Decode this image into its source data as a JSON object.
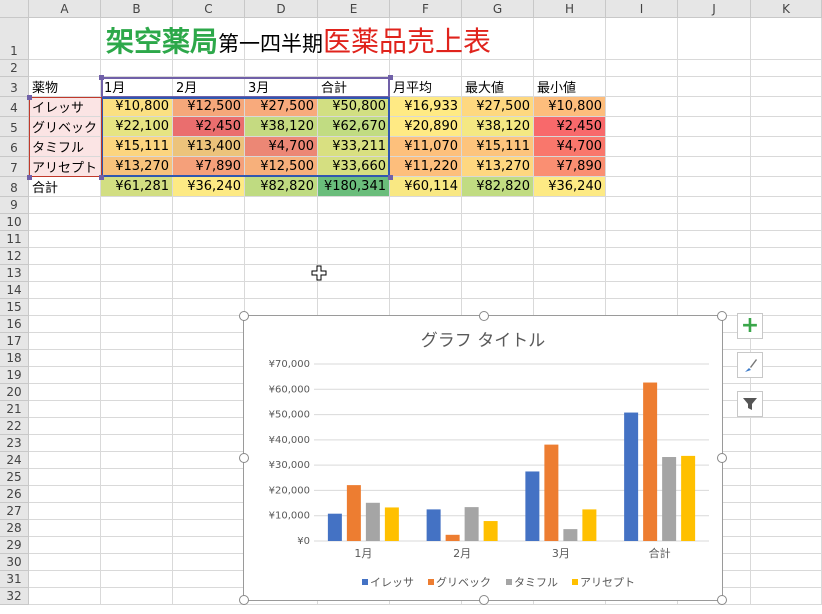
{
  "columns": [
    "A",
    "B",
    "C",
    "D",
    "E",
    "F",
    "G",
    "H",
    "I",
    "J",
    "K"
  ],
  "rows": [
    "1",
    "2",
    "3",
    "4",
    "5",
    "6",
    "7",
    "8",
    "9",
    "10",
    "11",
    "12",
    "13",
    "14",
    "15",
    "16",
    "17",
    "18",
    "19",
    "20",
    "21",
    "22",
    "23",
    "24",
    "25",
    "26",
    "27",
    "28",
    "29",
    "30",
    "31",
    "32"
  ],
  "title": {
    "part1": "架空薬局",
    "part2": "第一四半期",
    "part3": "医薬品売上表"
  },
  "headers": [
    "薬物",
    "1月",
    "2月",
    "3月",
    "合計",
    "月平均",
    "最大値",
    "最小値"
  ],
  "table": [
    {
      "name": "イレッサ",
      "values": [
        "¥10,800",
        "¥12,500",
        "¥27,500",
        "¥50,800",
        "¥16,933",
        "¥27,500",
        "¥10,800"
      ]
    },
    {
      "name": "グリベック",
      "values": [
        "¥22,100",
        "¥2,450",
        "¥38,120",
        "¥62,670",
        "¥20,890",
        "¥38,120",
        "¥2,450"
      ]
    },
    {
      "name": "タミフル",
      "values": [
        "¥15,111",
        "¥13,400",
        "¥4,700",
        "¥33,211",
        "¥11,070",
        "¥15,111",
        "¥4,700"
      ]
    },
    {
      "name": "アリセプト",
      "values": [
        "¥13,270",
        "¥7,890",
        "¥12,500",
        "¥33,660",
        "¥11,220",
        "¥13,270",
        "¥7,890"
      ]
    }
  ],
  "total": {
    "name": "合計",
    "values": [
      "¥61,281",
      "¥36,240",
      "¥82,820",
      "¥180,341",
      "¥60,114",
      "¥82,820",
      "¥36,240"
    ]
  },
  "colors": {
    "title_green": "#2da84a",
    "title_red": "#e0231c",
    "sel_purple": "#7060a8",
    "header_fill": "#e6e6e6"
  },
  "cell_fills": [
    [
      "#fbe4e4",
      "#fbe082",
      "#f5a77a",
      "#f8aa7c",
      "#d2df82",
      "#ffea84",
      "#fed880",
      "#fdbd7c"
    ],
    [
      "#fbe4e4",
      "#e6e483",
      "#ea6e6e",
      "#c5da81",
      "#c1dc82",
      "#ffea84",
      "#f4e883",
      "#f8696b"
    ],
    [
      "#fbe4e4",
      "#fcd57f",
      "#ecc37b",
      "#ec8775",
      "#d9e081",
      "#fdc07c",
      "#fdc47d",
      "#f9776c"
    ],
    [
      "#fbe4e4",
      "#f7c27c",
      "#f5a07a",
      "#f7b07b",
      "#d5df81",
      "#fdbe7c",
      "#fed780",
      "#fa8f72"
    ],
    [
      "#ffffff",
      "#d2de82",
      "#fdea84",
      "#bfdb81",
      "#6abd7b",
      "#f9e883",
      "#c1dc82",
      "#fdea84"
    ]
  ],
  "side_buttons": {
    "add": "plus-icon",
    "style": "brush-icon",
    "filter": "filter-icon"
  },
  "chart_data": {
    "type": "bar",
    "title": "グラフ タイトル",
    "categories": [
      "1月",
      "2月",
      "3月",
      "合計"
    ],
    "series": [
      {
        "name": "イレッサ",
        "color": "#4472c4",
        "values": [
          10800,
          12500,
          27500,
          50800
        ]
      },
      {
        "name": "グリベック",
        "color": "#ed7d31",
        "values": [
          22100,
          2450,
          38120,
          62670
        ]
      },
      {
        "name": "タミフル",
        "color": "#a5a5a5",
        "values": [
          15111,
          13400,
          4700,
          33211
        ]
      },
      {
        "name": "アリセプト",
        "color": "#ffc000",
        "values": [
          13270,
          7890,
          12500,
          33660
        ]
      }
    ],
    "ylim": [
      0,
      70000
    ],
    "yticks": [
      "¥0",
      "¥10,000",
      "¥20,000",
      "¥30,000",
      "¥40,000",
      "¥50,000",
      "¥60,000",
      "¥70,000"
    ],
    "grid": true,
    "legend": "bottom"
  }
}
